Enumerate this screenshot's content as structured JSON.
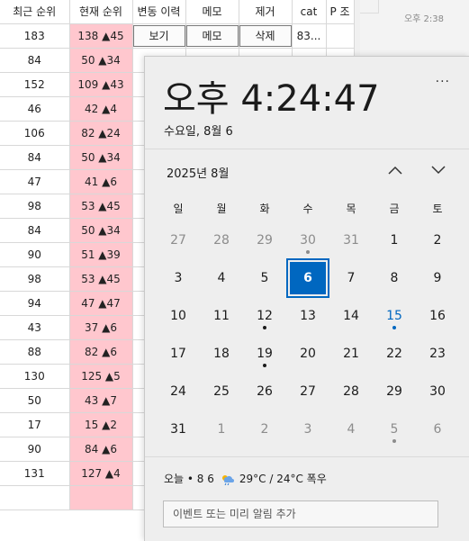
{
  "table": {
    "headers": [
      "최근 순위",
      "현재 순위",
      "변동 이력",
      "메모",
      "제거",
      "cat",
      "P 조"
    ],
    "first_row_actions": {
      "history": "보기",
      "memo": "메모",
      "remove": "삭제",
      "cat": "83..."
    },
    "rows": [
      {
        "recent": "183",
        "current": "138 ▲45"
      },
      {
        "recent": "84",
        "current": "50 ▲34"
      },
      {
        "recent": "152",
        "current": "109 ▲43"
      },
      {
        "recent": "46",
        "current": "42 ▲4"
      },
      {
        "recent": "106",
        "current": "82 ▲24"
      },
      {
        "recent": "84",
        "current": "50 ▲34"
      },
      {
        "recent": "47",
        "current": "41 ▲6"
      },
      {
        "recent": "98",
        "current": "53 ▲45"
      },
      {
        "recent": "84",
        "current": "50 ▲34"
      },
      {
        "recent": "90",
        "current": "51 ▲39"
      },
      {
        "recent": "98",
        "current": "53 ▲45"
      },
      {
        "recent": "94",
        "current": "47 ▲47"
      },
      {
        "recent": "43",
        "current": "37 ▲6"
      },
      {
        "recent": "88",
        "current": "82 ▲6"
      },
      {
        "recent": "130",
        "current": "125 ▲5"
      },
      {
        "recent": "50",
        "current": "43 ▲7"
      },
      {
        "recent": "17",
        "current": "15 ▲2"
      },
      {
        "recent": "90",
        "current": "84 ▲6"
      },
      {
        "recent": "131",
        "current": "127 ▲4"
      },
      {
        "recent": "",
        "current": ""
      }
    ],
    "current_highlight_color": "#ffc7ce"
  },
  "notification_time": "오후 2:38",
  "flyout": {
    "clock": "오후 4:24:47",
    "more_label": "···",
    "date": "수요일, 8월 6",
    "month": "2025년 8월",
    "weekdays": [
      "일",
      "월",
      "화",
      "수",
      "목",
      "금",
      "토"
    ],
    "days": [
      {
        "n": "27",
        "other": true
      },
      {
        "n": "28",
        "other": true
      },
      {
        "n": "29",
        "other": true
      },
      {
        "n": "30",
        "other": true,
        "dot": true
      },
      {
        "n": "31",
        "other": true
      },
      {
        "n": "1"
      },
      {
        "n": "2"
      },
      {
        "n": "3"
      },
      {
        "n": "4"
      },
      {
        "n": "5"
      },
      {
        "n": "6",
        "today": true
      },
      {
        "n": "7"
      },
      {
        "n": "8"
      },
      {
        "n": "9"
      },
      {
        "n": "10"
      },
      {
        "n": "11"
      },
      {
        "n": "12",
        "dot": true
      },
      {
        "n": "13"
      },
      {
        "n": "14"
      },
      {
        "n": "15",
        "dot": true,
        "blue": true
      },
      {
        "n": "16"
      },
      {
        "n": "17"
      },
      {
        "n": "18"
      },
      {
        "n": "19",
        "dot": true
      },
      {
        "n": "20"
      },
      {
        "n": "21"
      },
      {
        "n": "22"
      },
      {
        "n": "23"
      },
      {
        "n": "24"
      },
      {
        "n": "25"
      },
      {
        "n": "26"
      },
      {
        "n": "27"
      },
      {
        "n": "28"
      },
      {
        "n": "29"
      },
      {
        "n": "30"
      },
      {
        "n": "31"
      },
      {
        "n": "1",
        "other": true
      },
      {
        "n": "2",
        "other": true
      },
      {
        "n": "3",
        "other": true
      },
      {
        "n": "4",
        "other": true
      },
      {
        "n": "5",
        "other": true,
        "dot": true
      },
      {
        "n": "6",
        "other": true
      }
    ],
    "today_label": "오늘 • 8 6",
    "weather": "29°C / 24°C 폭우",
    "event_placeholder": "이벤트 또는 미리 알림 추가",
    "accent": "#0067c0"
  }
}
